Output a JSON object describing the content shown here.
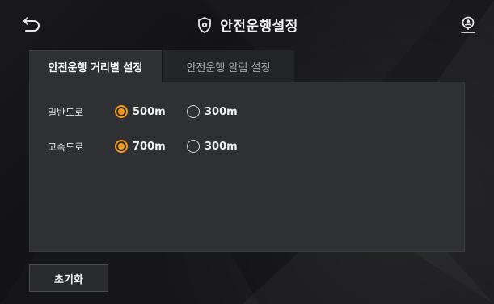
{
  "header": {
    "title": "안전운행설정",
    "back_icon": "back-icon",
    "title_icon": "shield-gear-icon",
    "profile_icon": "user-location-icon"
  },
  "tabs": [
    {
      "label": "안전운행 거리별 설정",
      "active": true
    },
    {
      "label": "안전운행 알림 설정",
      "active": false
    }
  ],
  "settings": {
    "rows": [
      {
        "label": "일반도로",
        "options": [
          {
            "label": "500m",
            "selected": true
          },
          {
            "label": "300m",
            "selected": false
          }
        ]
      },
      {
        "label": "고속도로",
        "options": [
          {
            "label": "700m",
            "selected": true
          },
          {
            "label": "300m",
            "selected": false
          }
        ]
      }
    ]
  },
  "footer": {
    "reset_label": "초기화"
  },
  "colors": {
    "accent": "#f39a1f",
    "panel": "#2f3033",
    "background": "#111113"
  }
}
